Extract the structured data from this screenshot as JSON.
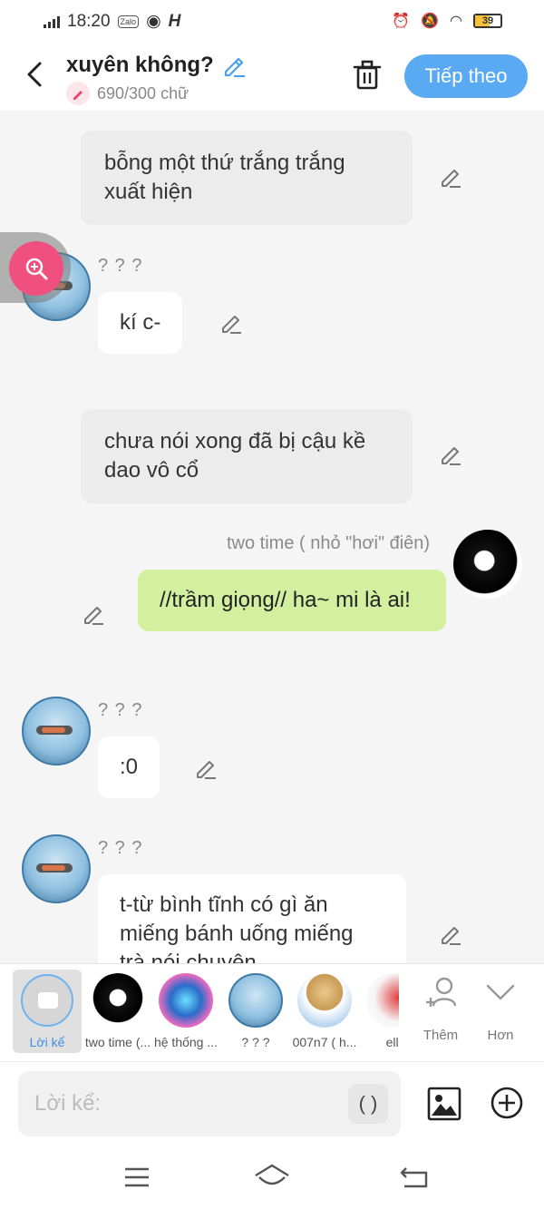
{
  "status": {
    "time": "18:20",
    "app_badge": "Zalo",
    "battery": "39"
  },
  "header": {
    "title": "xuyên không?",
    "word_count": "690/300 chữ",
    "next_label": "Tiếp theo"
  },
  "messages": [
    {
      "kind": "narration",
      "text": "bỗng một thứ trắng trắng xuất hiện"
    },
    {
      "kind": "character",
      "name": "? ? ?",
      "text": "kí c-"
    },
    {
      "kind": "narration",
      "text": "chưa nói xong đã bị cậu kề dao vô cổ"
    },
    {
      "kind": "self",
      "name": "two time ( nhỏ \"hơi\" điên)",
      "text": "//trầm giọng// ha~ mi là ai!"
    },
    {
      "kind": "character",
      "name": "? ? ?",
      "text": ":0"
    },
    {
      "kind": "character",
      "name": "? ? ?",
      "text": "t-từ bình tĩnh có gì ăn miếng bánh uống miếng trà nói chuyện"
    }
  ],
  "characters": [
    {
      "label": "Lời kể"
    },
    {
      "label": "two time (..."
    },
    {
      "label": "hệ thống ..."
    },
    {
      "label": "? ? ?"
    },
    {
      "label": "007n7 ( h..."
    },
    {
      "label": "elliot"
    }
  ],
  "actions": {
    "add_label": "Thêm",
    "more_label": "Hơn"
  },
  "input": {
    "placeholder": "Lời kể:",
    "paren_label": "( )"
  },
  "colors": {
    "accent": "#5aaaf3",
    "self_bubble": "#d3f0a0",
    "zoom": "#f0507f"
  }
}
